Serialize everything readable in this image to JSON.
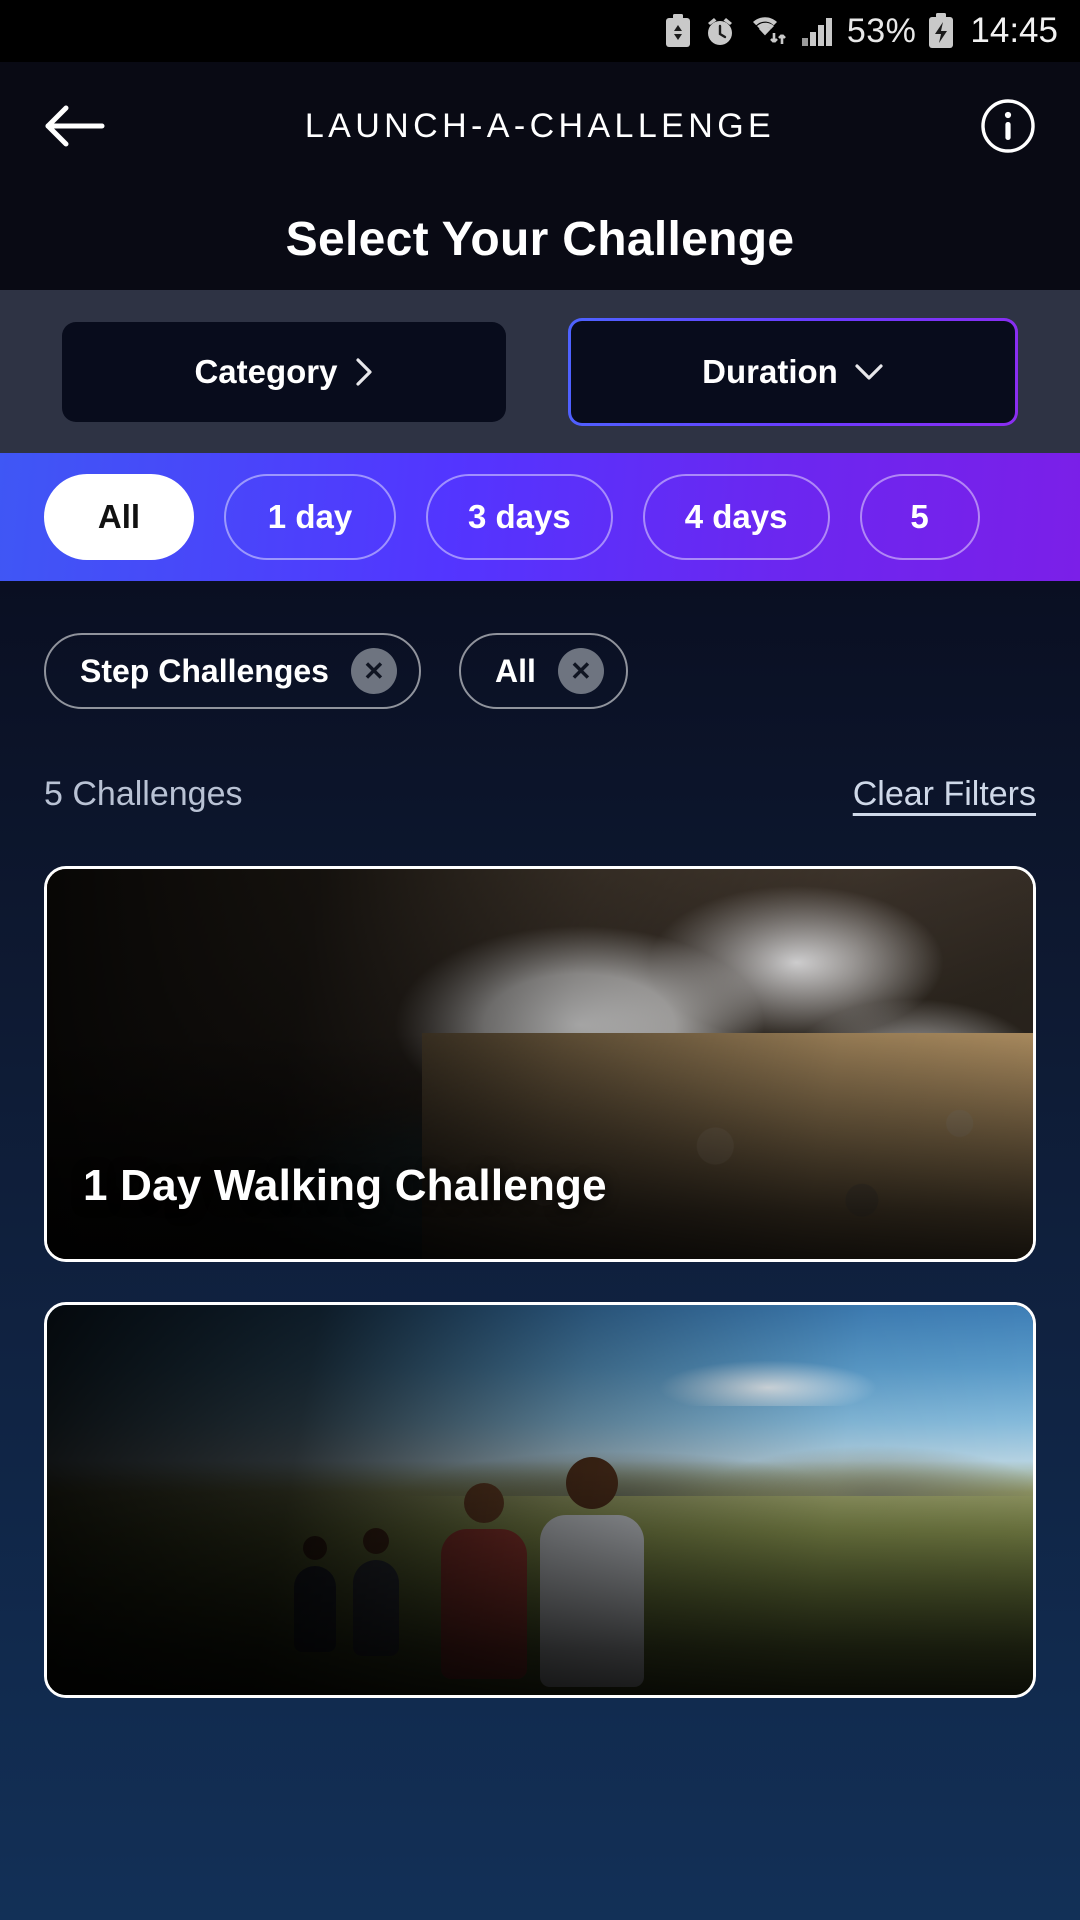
{
  "status_bar": {
    "icons": [
      "battery-saver-icon",
      "alarm-icon",
      "wifi-icon",
      "signal-icon"
    ],
    "battery_percent": "53%",
    "time": "14:45"
  },
  "header": {
    "back_label": "Back",
    "app_title": "LAUNCH-A-CHALLENGE",
    "info_label": "Info",
    "page_heading": "Select Your Challenge"
  },
  "filters": {
    "category": {
      "label": "Category",
      "icon": "chevron-right-icon",
      "active": false
    },
    "duration": {
      "label": "Duration",
      "icon": "chevron-down-icon",
      "active": true
    }
  },
  "duration_options": [
    {
      "label": "All",
      "selected": true
    },
    {
      "label": "1 day",
      "selected": false
    },
    {
      "label": "3 days",
      "selected": false
    },
    {
      "label": "4 days",
      "selected": false
    },
    {
      "label": "5",
      "selected": false
    }
  ],
  "active_chips": [
    {
      "label": "Step Challenges",
      "remove_icon": "close-icon"
    },
    {
      "label": "All",
      "remove_icon": "close-icon"
    }
  ],
  "results": {
    "count_label": "5 Challenges",
    "clear_filters_label": "Clear Filters"
  },
  "cards": [
    {
      "title": "1 Day Walking Challenge",
      "photo": "crater-lake-hikers"
    },
    {
      "title": "",
      "photo": "hikers-in-field"
    }
  ],
  "colors": {
    "accent_blue": "#4d63ff",
    "accent_purple": "#8b2df0",
    "header_bg": "#090a14",
    "filterbar_bg": "#2e3344",
    "content_top": "#0a0f22",
    "content_bottom": "#123057"
  }
}
